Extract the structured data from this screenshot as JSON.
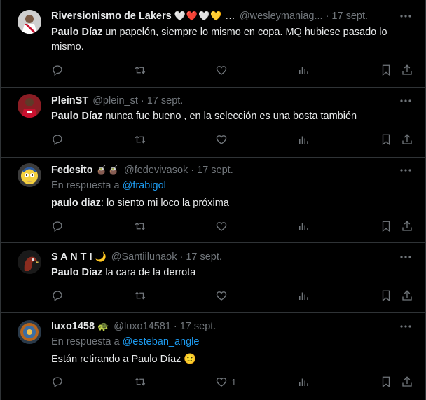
{
  "tweets": [
    {
      "name": "Riversionismo de Lakers",
      "emoji": "🤍❤️🤍💛 ...",
      "handle": "@wesleymaniag...",
      "time": "17 sept.",
      "mention": "Paulo Díaz",
      "text": " un papelón, siempre lo mismo en copa. MQ hubiese pasado lo mismo.",
      "likes": ""
    },
    {
      "name": "PleinST",
      "emoji": "",
      "handle": "@plein_st",
      "time": "17 sept.",
      "mention": "Paulo Díaz",
      "text": " nunca fue bueno , en la selección es una bosta también",
      "likes": ""
    },
    {
      "name": "Fedesito",
      "emoji": "🧉🧉",
      "handle": "@fedevivasok",
      "time": "17 sept.",
      "reply_prefix": "En respuesta a ",
      "reply_link": "@frabigol",
      "mention": "paulo diaz",
      "text": ": lo siento mi loco la próxima",
      "likes": ""
    },
    {
      "name": "S A N T I",
      "emoji": "🌙",
      "handle": "@Santiilunaok",
      "time": "17 sept.",
      "mention": "Paulo Díaz",
      "text": " la cara de la derrota",
      "likes": ""
    },
    {
      "name": "luxo1458",
      "emoji": "🐢",
      "handle": "@luxo14581",
      "time": "17 sept.",
      "reply_prefix": "En respuesta a ",
      "reply_link": "@esteban_angle",
      "mention": "",
      "text": "Están retirando a Paulo Díaz 🙂",
      "likes": "1"
    }
  ],
  "icons": {
    "reply": "reply-icon",
    "retweet": "retweet-icon",
    "like": "heart-icon",
    "views": "views-icon",
    "bookmark": "bookmark-icon",
    "share": "share-icon",
    "more": "more-icon"
  },
  "colors": {
    "background": "#000000",
    "text": "#e7e9ea",
    "muted": "#71767b",
    "link": "#1d9bf0",
    "border": "#2f3336"
  }
}
